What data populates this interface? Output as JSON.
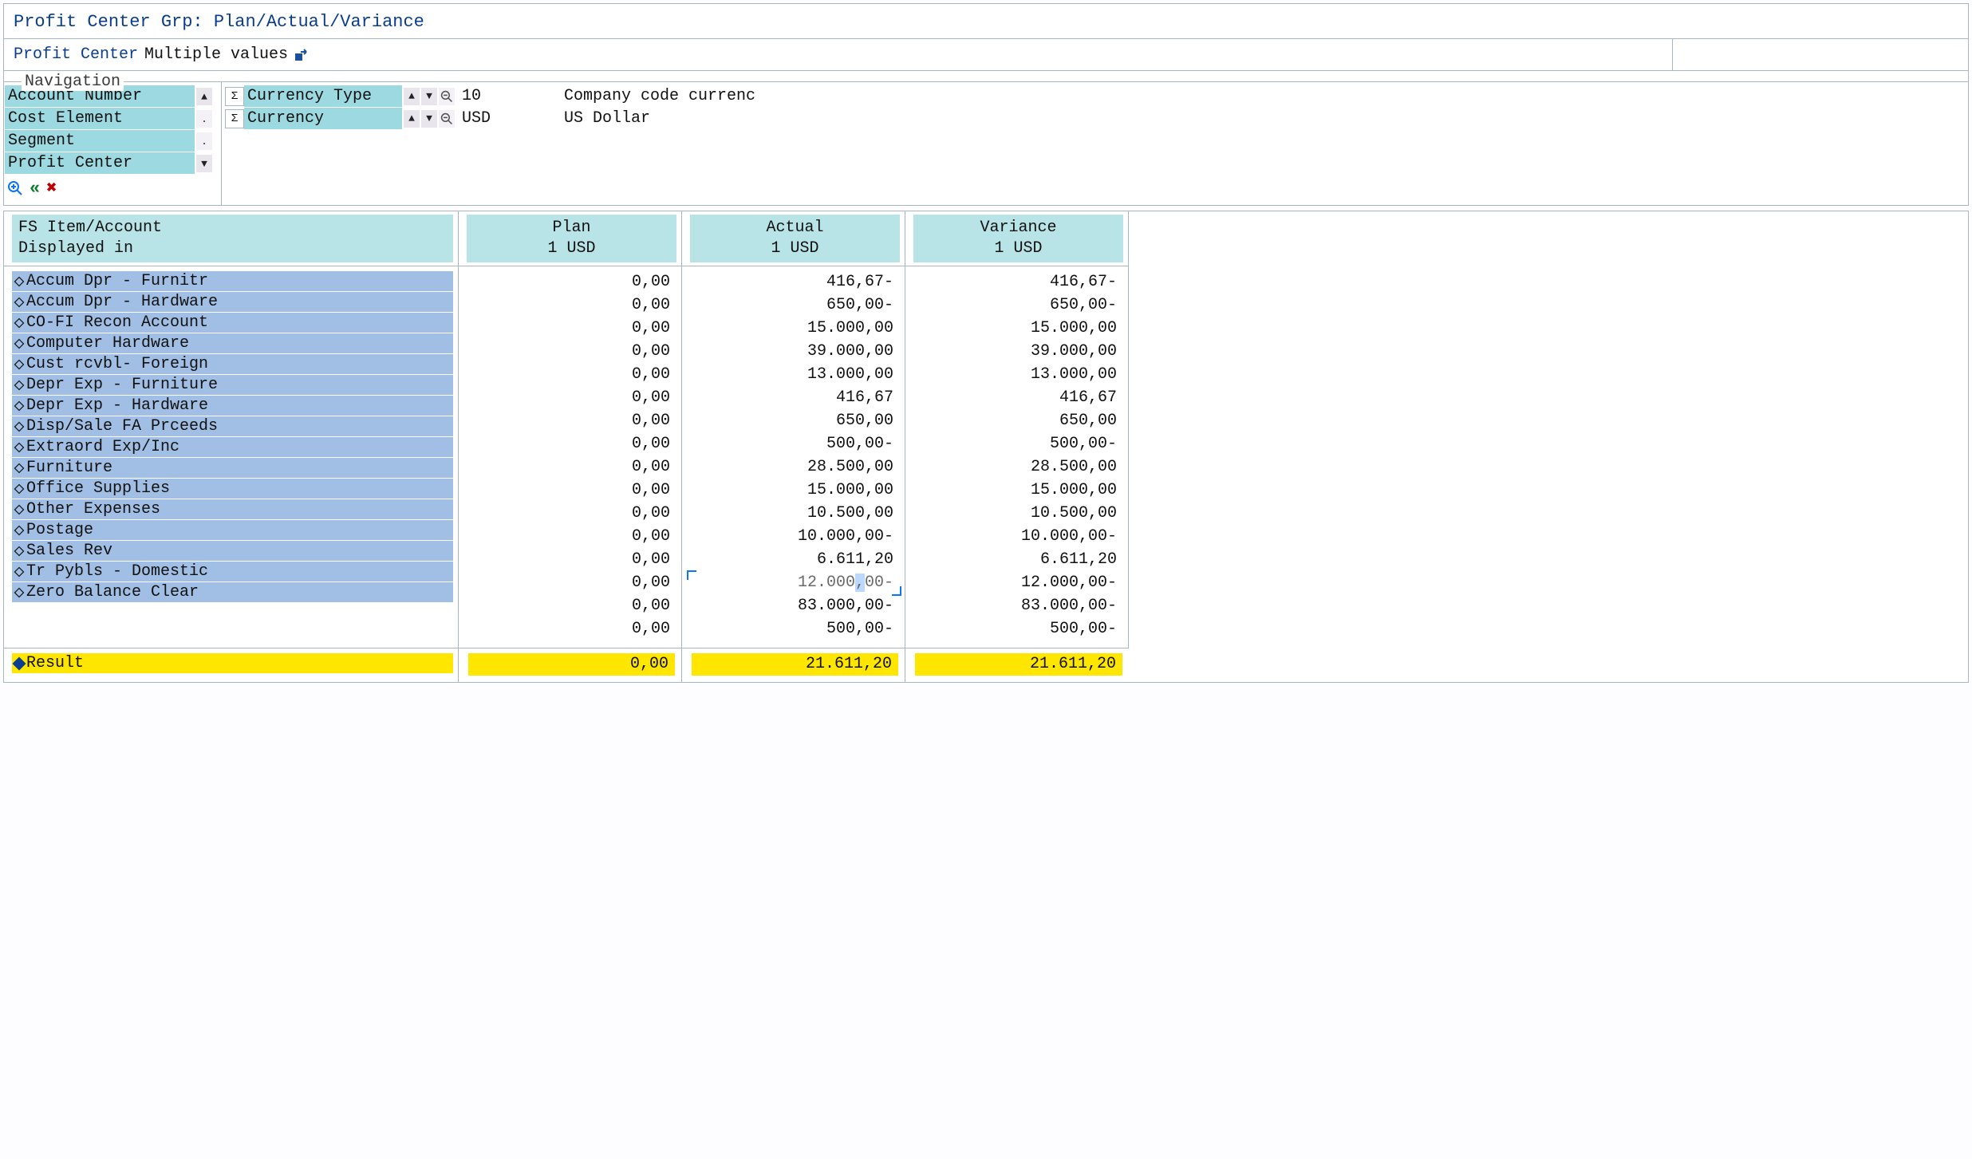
{
  "header": {
    "title": "Profit Center Grp: Plan/Actual/Variance",
    "profit_center_label": "Profit Center",
    "profit_center_value": "Multiple values"
  },
  "navigation": {
    "legend": "Navigation",
    "left_items": [
      {
        "label": "Account Number",
        "ctrl": "up"
      },
      {
        "label": "Cost Element",
        "ctrl": "dot"
      },
      {
        "label": "Segment",
        "ctrl": "dot"
      },
      {
        "label": "Profit Center",
        "ctrl": "down"
      }
    ],
    "right_items": [
      {
        "label": "Currency Type",
        "value": "10",
        "desc": "Company code currenc"
      },
      {
        "label": "Currency",
        "value": "USD",
        "desc": "US Dollar"
      }
    ]
  },
  "columns": {
    "c0a": "FS Item/Account",
    "c0b": "Displayed in",
    "c1a": "Plan",
    "c1b": "1 USD",
    "c2a": "Actual",
    "c2b": "1 USD",
    "c3a": "Variance",
    "c3b": "1 USD"
  },
  "rows": [
    {
      "label": "Accum Dpr - Furnitr",
      "plan": "0,00",
      "actual": "416,67-",
      "variance": "416,67-"
    },
    {
      "label": "Accum Dpr - Hardware",
      "plan": "0,00",
      "actual": "650,00-",
      "variance": "650,00-"
    },
    {
      "label": "CO-FI Recon Account",
      "plan": "0,00",
      "actual": "15.000,00",
      "variance": "15.000,00"
    },
    {
      "label": "Computer Hardware",
      "plan": "0,00",
      "actual": "39.000,00",
      "variance": "39.000,00"
    },
    {
      "label": "Cust rcvbl- Foreign",
      "plan": "0,00",
      "actual": "13.000,00",
      "variance": "13.000,00"
    },
    {
      "label": "Depr Exp - Furniture",
      "plan": "0,00",
      "actual": "416,67",
      "variance": "416,67"
    },
    {
      "label": "Depr Exp - Hardware",
      "plan": "0,00",
      "actual": "650,00",
      "variance": "650,00"
    },
    {
      "label": "Disp/Sale FA Prceeds",
      "plan": "0,00",
      "actual": "500,00-",
      "variance": "500,00-"
    },
    {
      "label": "Extraord Exp/Inc",
      "plan": "0,00",
      "actual": "28.500,00",
      "variance": "28.500,00"
    },
    {
      "label": "Furniture",
      "plan": "0,00",
      "actual": "15.000,00",
      "variance": "15.000,00"
    },
    {
      "label": "Office Supplies",
      "plan": "0,00",
      "actual": "10.500,00",
      "variance": "10.500,00"
    },
    {
      "label": "Other Expenses",
      "plan": "0,00",
      "actual": "10.000,00-",
      "variance": "10.000,00-"
    },
    {
      "label": "Postage",
      "plan": "0,00",
      "actual": "6.611,20",
      "variance": "6.611,20"
    },
    {
      "label": "Sales Rev",
      "plan": "0,00",
      "actual": "12.000,00-",
      "variance": "12.000,00-",
      "selected": true
    },
    {
      "label": "Tr Pybls - Domestic",
      "plan": "0,00",
      "actual": "83.000,00-",
      "variance": "83.000,00-"
    },
    {
      "label": "Zero Balance Clear",
      "plan": "0,00",
      "actual": "500,00-",
      "variance": "500,00-"
    }
  ],
  "result": {
    "label": "Result",
    "plan": "0,00",
    "actual": "21.611,20",
    "variance": "21.611,20"
  },
  "chart_data": {
    "type": "table",
    "title": "Profit Center Grp: Plan/Actual/Variance",
    "categories": [
      "Accum Dpr - Furnitr",
      "Accum Dpr - Hardware",
      "CO-FI Recon Account",
      "Computer Hardware",
      "Cust rcvbl- Foreign",
      "Depr Exp - Furniture",
      "Depr Exp - Hardware",
      "Disp/Sale FA Prceeds",
      "Extraord Exp/Inc",
      "Furniture",
      "Office Supplies",
      "Other Expenses",
      "Postage",
      "Sales Rev",
      "Tr Pybls - Domestic",
      "Zero Balance Clear"
    ],
    "series": [
      {
        "name": "Plan (USD)",
        "values": [
          0,
          0,
          0,
          0,
          0,
          0,
          0,
          0,
          0,
          0,
          0,
          0,
          0,
          0,
          0,
          0
        ]
      },
      {
        "name": "Actual (USD)",
        "values": [
          -416.67,
          -650.0,
          15000.0,
          39000.0,
          13000.0,
          416.67,
          650.0,
          -500.0,
          28500.0,
          15000.0,
          10500.0,
          -10000.0,
          6611.2,
          -12000.0,
          -83000.0,
          -500.0
        ]
      },
      {
        "name": "Variance (USD)",
        "values": [
          -416.67,
          -650.0,
          15000.0,
          39000.0,
          13000.0,
          416.67,
          650.0,
          -500.0,
          28500.0,
          15000.0,
          10500.0,
          -10000.0,
          6611.2,
          -12000.0,
          -83000.0,
          -500.0
        ]
      }
    ],
    "totals": {
      "Plan (USD)": 0.0,
      "Actual (USD)": 21611.2,
      "Variance (USD)": 21611.2
    }
  }
}
